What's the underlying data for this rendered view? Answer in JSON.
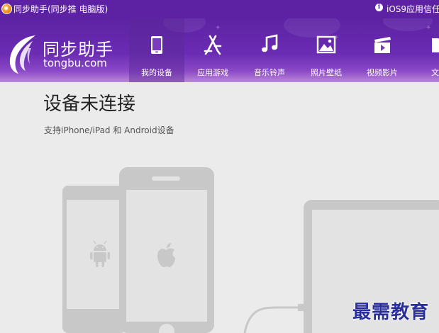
{
  "titlebar": {
    "title": "同步助手(同步推 电脑版)",
    "info_icon": "i",
    "notice": "iOS9应用信任"
  },
  "logo": {
    "name_cn": "同步助手",
    "name_en": "tongbu.com"
  },
  "nav": {
    "items": [
      {
        "label": "我的设备",
        "icon": "phone-icon",
        "active": true
      },
      {
        "label": "应用游戏",
        "icon": "app-store-icon",
        "active": false
      },
      {
        "label": "音乐铃声",
        "icon": "music-note-icon",
        "active": false
      },
      {
        "label": "照片壁纸",
        "icon": "picture-icon",
        "active": false
      },
      {
        "label": "视频影片",
        "icon": "video-clapper-icon",
        "active": false
      },
      {
        "label": "文件",
        "icon": "file-icon",
        "active": false
      }
    ]
  },
  "main": {
    "heading": "设备未连接",
    "subtitle": "支持iPhone/iPad 和 Android设备"
  },
  "watermark": "最需教育",
  "colors": {
    "header": "#5d22a3",
    "content_bg": "#ebebeb",
    "device_gray": "#c8c8c8"
  }
}
